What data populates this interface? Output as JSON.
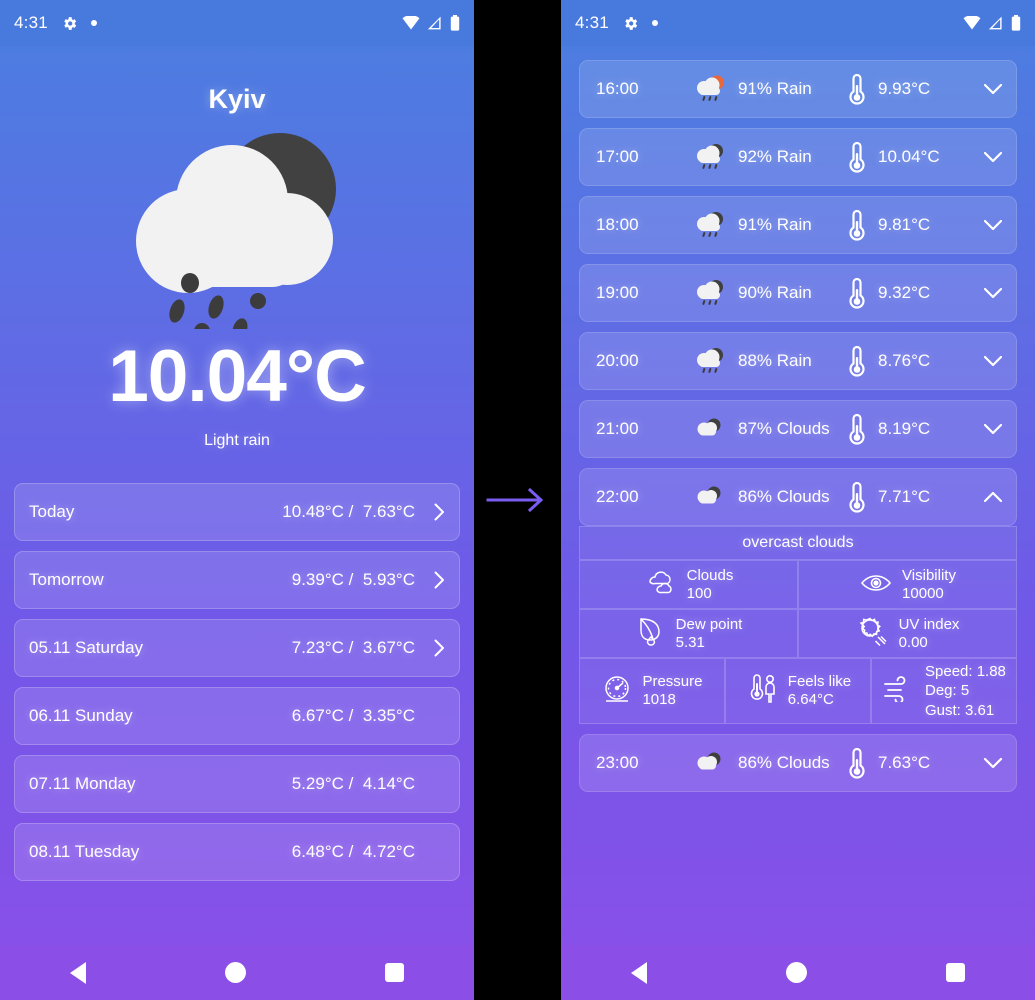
{
  "status_bar": {
    "time": "4:31",
    "icons": [
      "gear-icon",
      "dot-indicator",
      "wifi-icon",
      "cellular-signal-icon",
      "battery-icon"
    ]
  },
  "colors": {
    "gradient_top": "#4a7fe0",
    "gradient_bottom": "#8b4fe8",
    "status_bar": "#4879dd",
    "nav_bar": "#8b4fe8",
    "arrow": "#7a5cf0",
    "sun": "#e8683c",
    "cloud_dark": "#3f3f3f",
    "cloud_light": "#f2f2f2"
  },
  "current": {
    "city": "Kyiv",
    "temperature": "10.04°C",
    "description": "Light rain",
    "icon": "cloud-moon-rain-icon"
  },
  "daily": {
    "rows": [
      {
        "name": "Today",
        "high": "10.48°C",
        "low": "7.63°C",
        "sep": "/",
        "chevron": true
      },
      {
        "name": "Tomorrow",
        "high": "9.39°C",
        "low": "5.93°C",
        "sep": "/",
        "chevron": true
      },
      {
        "name": "05.11 Saturday",
        "high": "7.23°C",
        "low": "3.67°C",
        "sep": "/",
        "chevron": true
      },
      {
        "name": "06.11 Sunday",
        "high": "6.67°C",
        "low": "3.35°C",
        "sep": "/",
        "chevron": false
      },
      {
        "name": "07.11 Monday",
        "high": "5.29°C",
        "low": "4.14°C",
        "sep": "/",
        "chevron": false
      },
      {
        "name": "08.11 Tuesday",
        "high": "6.48°C",
        "low": "4.72°C",
        "sep": "/",
        "chevron": false
      }
    ]
  },
  "hourly": {
    "rows": [
      {
        "time": "16:00",
        "condition": "91% Rain",
        "temp": "9.93°C",
        "icon": "sun-cloud-rain-icon",
        "chevron": "down"
      },
      {
        "time": "17:00",
        "condition": "92% Rain",
        "temp": "10.04°C",
        "icon": "moon-cloud-rain-icon",
        "chevron": "down"
      },
      {
        "time": "18:00",
        "condition": "91% Rain",
        "temp": "9.81°C",
        "icon": "moon-cloud-rain-icon",
        "chevron": "down"
      },
      {
        "time": "19:00",
        "condition": "90% Rain",
        "temp": "9.32°C",
        "icon": "moon-cloud-rain-icon",
        "chevron": "down"
      },
      {
        "time": "20:00",
        "condition": "88% Rain",
        "temp": "8.76°C",
        "icon": "moon-cloud-rain-icon",
        "chevron": "down"
      },
      {
        "time": "21:00",
        "condition": "87% Clouds",
        "temp": "8.19°C",
        "icon": "clouds-icon",
        "chevron": "down"
      },
      {
        "time": "22:00",
        "condition": "86% Clouds",
        "temp": "7.71°C",
        "icon": "clouds-icon",
        "chevron": "up"
      },
      {
        "time": "23:00",
        "condition": "86% Clouds",
        "temp": "7.63°C",
        "icon": "clouds-icon",
        "chevron": "down"
      }
    ],
    "expanded_index": 6,
    "expanded": {
      "title": "overcast clouds",
      "details": [
        {
          "label": "Clouds",
          "value": "100",
          "icon": "clouds-outline-icon"
        },
        {
          "label": "Visibility",
          "value": "10000",
          "icon": "eye-icon"
        },
        {
          "label": "Dew point",
          "value": "5.31",
          "icon": "leaf-drop-icon"
        },
        {
          "label": "UV index",
          "value": "0.00",
          "icon": "uv-sun-icon"
        },
        {
          "label": "Pressure",
          "value": "1018",
          "icon": "gauge-icon"
        },
        {
          "label": "Feels like",
          "value": "6.64°C",
          "icon": "thermometer-person-icon"
        }
      ],
      "wind": {
        "icon": "wind-icon",
        "speed": "Speed: 1.88",
        "deg": "Deg: 5",
        "gust": "Gust: 3.61"
      }
    }
  },
  "transition": {
    "arrow": "right-arrow-icon"
  },
  "nav_bar": {
    "back": "back-triangle-icon",
    "home": "home-circle-icon",
    "recents": "recents-square-icon"
  }
}
